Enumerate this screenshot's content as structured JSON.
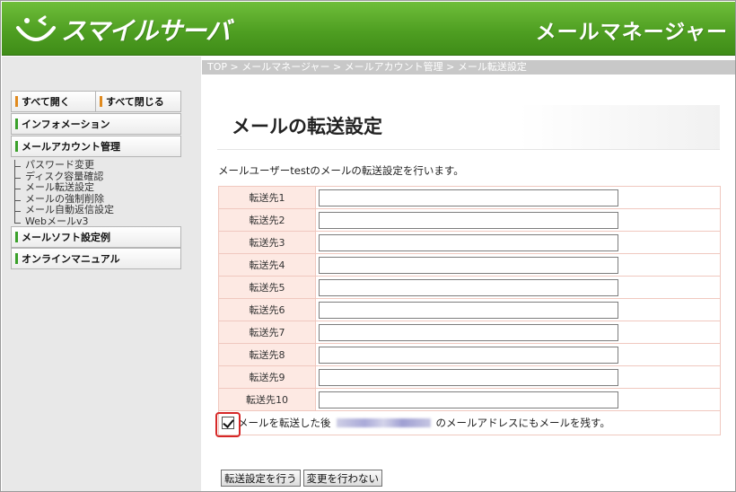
{
  "header": {
    "brand": "スマイルサーバ",
    "app_title": "メールマネージャー"
  },
  "breadcrumb": "TOP > メールマネージャー > メールアカウント管理 > メール転送設定",
  "sidebar": {
    "open_all": "すべて開く",
    "close_all": "すべて閉じる",
    "menu": {
      "information": "インフォメーション",
      "mail_account": "メールアカウント管理",
      "mail_soft": "メールソフト設定例",
      "online_manual": "オンラインマニュアル"
    },
    "submenu": [
      "パスワード変更",
      "ディスク容量確認",
      "メール転送設定",
      "メールの強制削除",
      "メール自動返信設定",
      "Webメールv3"
    ]
  },
  "page": {
    "title": "メールの転送設定",
    "description": "メールユーザーtestのメールの転送設定を行います。",
    "forward_labels": [
      "転送先1",
      "転送先2",
      "転送先3",
      "転送先4",
      "転送先5",
      "転送先6",
      "転送先7",
      "転送先8",
      "転送先9",
      "転送先10"
    ],
    "forward_values": [
      "",
      "",
      "",
      "",
      "",
      "",
      "",
      "",
      "",
      ""
    ],
    "keep_copy_before": "メールを転送した後",
    "keep_copy_after": "のメールアドレスにもメールを残す。",
    "keep_copy_checked": true,
    "submit": "転送設定を行う",
    "cancel": "変更を行わない"
  },
  "colors": {
    "header_green": "#4f9f22",
    "label_bg": "#fde9e3",
    "highlight_ring": "#d62828"
  }
}
